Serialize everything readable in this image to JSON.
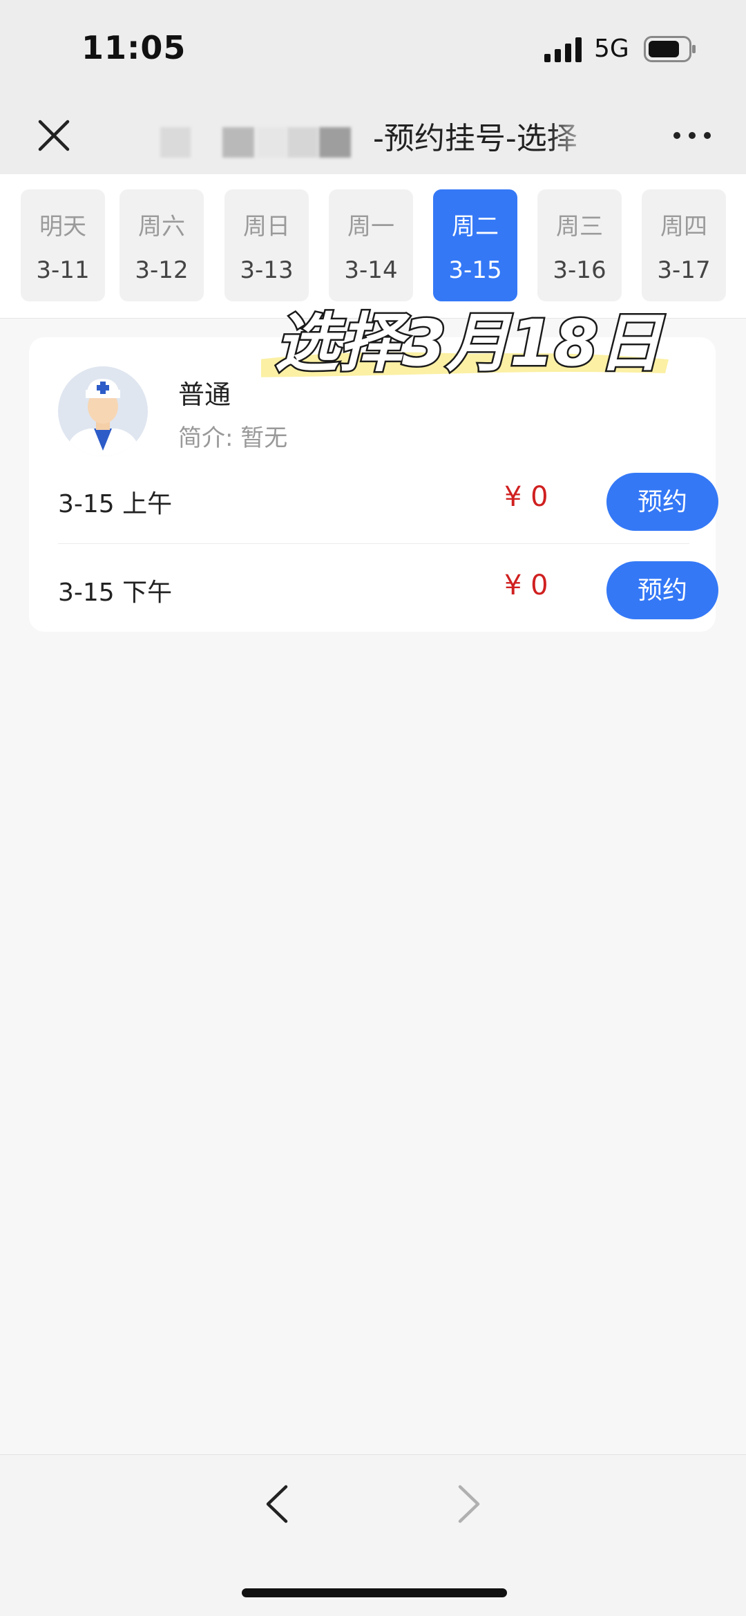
{
  "status_bar": {
    "time": "11:05",
    "network": "5G",
    "icons": [
      "signal-icon",
      "battery-icon"
    ]
  },
  "nav": {
    "title": "-预约挂号-选择",
    "icons": [
      "close-icon",
      "more-icon"
    ]
  },
  "date_tabs": [
    {
      "day": "明天",
      "date": "3-11",
      "active": false
    },
    {
      "day": "周六",
      "date": "3-12",
      "active": false
    },
    {
      "day": "周日",
      "date": "3-13",
      "active": false
    },
    {
      "day": "周一",
      "date": "3-14",
      "active": false
    },
    {
      "day": "周二",
      "date": "3-15",
      "active": true
    },
    {
      "day": "周三",
      "date": "3-16",
      "active": false
    },
    {
      "day": "周四",
      "date": "3-17",
      "active": false
    }
  ],
  "overlay_text": "选择3月18日",
  "doctor": {
    "name": "普通",
    "intro": "简介: 暂无",
    "avatar_icon": "doctor-avatar-icon"
  },
  "slots": [
    {
      "time": "3-15 上午",
      "price": "¥ 0",
      "button": "预约"
    },
    {
      "time": "3-15 下午",
      "price": "¥ 0",
      "button": "预约"
    }
  ],
  "bottom_nav": {
    "icons": [
      "chevron-left-icon",
      "chevron-right-icon"
    ]
  },
  "colors": {
    "accent": "#3478f6",
    "price": "#d02020",
    "header_bg": "#ededed",
    "page_bg": "#f7f7f7"
  }
}
